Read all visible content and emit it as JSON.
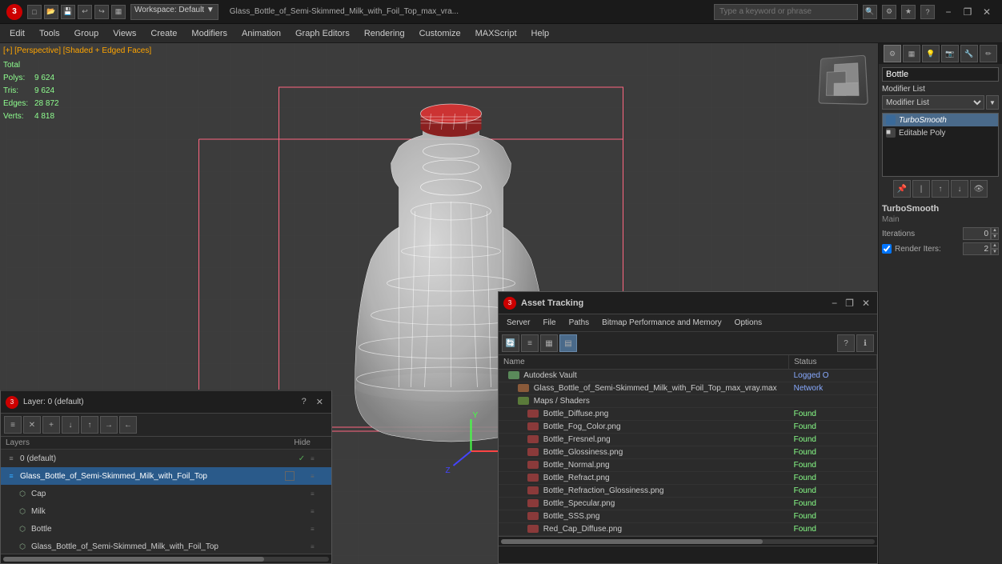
{
  "titlebar": {
    "logo_text": "3",
    "title": "Glass_Bottle_of_Semi-Skimmed_Milk_with_Foil_Top_max_vra...",
    "workspace_label": "Workspace: Default",
    "search_placeholder": "Type a keyword or phrase",
    "minimize": "−",
    "restore": "❐",
    "close": "✕"
  },
  "menubar": {
    "items": [
      "Edit",
      "Tools",
      "Group",
      "Views",
      "Create",
      "Modifiers",
      "Animation",
      "Graph Editors",
      "Rendering",
      "Customize",
      "MAXScript",
      "Help"
    ]
  },
  "viewport": {
    "label": "[+] [Perspective] [Shaded + Edged Faces]",
    "stats": {
      "polys_label": "Polys:",
      "polys_val": "9 624",
      "tris_label": "Tris:",
      "tris_val": "9 624",
      "edges_label": "Edges:",
      "edges_val": "28 872",
      "verts_label": "Verts:",
      "verts_val": "4 818",
      "total_label": "Total"
    }
  },
  "right_panel": {
    "obj_name": "Bottle",
    "modifier_list_label": "Modifier List",
    "modifiers": [
      {
        "name": "TurboSmooth",
        "active": true
      },
      {
        "name": "Editable Poly",
        "active": false
      }
    ],
    "properties_title": "TurboSmooth",
    "properties_subtitle": "Main",
    "iterations_label": "Iterations",
    "iterations_val": "0",
    "render_iters_label": "Render Iters:",
    "render_iters_val": "2"
  },
  "layer_panel": {
    "title": "Layer: 0 (default)",
    "header_name": "Layers",
    "header_hide": "Hide",
    "layers": [
      {
        "name": "0 (default)",
        "level": 0,
        "has_check": true,
        "icon": "layer"
      },
      {
        "name": "Glass_Bottle_of_Semi-Skimmed_Milk_with_Foil_Top",
        "level": 0,
        "selected": true,
        "has_box": true,
        "icon": "layer"
      },
      {
        "name": "Cap",
        "level": 1,
        "icon": "object"
      },
      {
        "name": "Milk",
        "level": 1,
        "icon": "object"
      },
      {
        "name": "Bottle",
        "level": 1,
        "icon": "object"
      },
      {
        "name": "Glass_Bottle_of_Semi-Skimmed_Milk_with_Foil_Top",
        "level": 1,
        "icon": "object"
      }
    ]
  },
  "asset_panel": {
    "title": "Asset Tracking",
    "menu_items": [
      "Server",
      "File",
      "Paths",
      "Bitmap Performance and Memory",
      "Options"
    ],
    "columns": [
      "Name",
      "Status"
    ],
    "rows": [
      {
        "indent": 1,
        "icon": "vault",
        "name": "Autodesk Vault",
        "status": "Logged O",
        "status_class": "network"
      },
      {
        "indent": 2,
        "icon": "max",
        "name": "Glass_Bottle_of_Semi-Skimmed_Milk_with_Foil_Top_max_vray.max",
        "status": "Network",
        "status_class": "network"
      },
      {
        "indent": 2,
        "icon": "maps",
        "name": "Maps / Shaders",
        "status": "",
        "status_class": ""
      },
      {
        "indent": 3,
        "icon": "png",
        "name": "Bottle_Diffuse.png",
        "status": "Found",
        "status_class": "found"
      },
      {
        "indent": 3,
        "icon": "png",
        "name": "Bottle_Fog_Color.png",
        "status": "Found",
        "status_class": "found"
      },
      {
        "indent": 3,
        "icon": "png",
        "name": "Bottle_Fresnel.png",
        "status": "Found",
        "status_class": "found"
      },
      {
        "indent": 3,
        "icon": "png",
        "name": "Bottle_Glossiness.png",
        "status": "Found",
        "status_class": "found"
      },
      {
        "indent": 3,
        "icon": "png",
        "name": "Bottle_Normal.png",
        "status": "Found",
        "status_class": "found"
      },
      {
        "indent": 3,
        "icon": "png",
        "name": "Bottle_Refract.png",
        "status": "Found",
        "status_class": "found"
      },
      {
        "indent": 3,
        "icon": "png",
        "name": "Bottle_Refraction_Glossiness.png",
        "status": "Found",
        "status_class": "found"
      },
      {
        "indent": 3,
        "icon": "png",
        "name": "Bottle_Specular.png",
        "status": "Found",
        "status_class": "found"
      },
      {
        "indent": 3,
        "icon": "png",
        "name": "Bottle_SSS.png",
        "status": "Found",
        "status_class": "found"
      },
      {
        "indent": 3,
        "icon": "png",
        "name": "Red_Cap_Diffuse.png",
        "status": "Found",
        "status_class": "found"
      }
    ]
  }
}
